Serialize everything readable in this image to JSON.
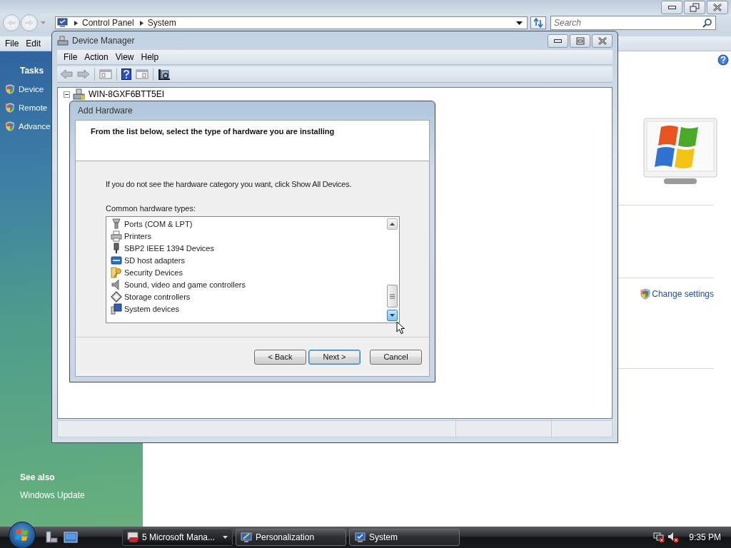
{
  "explorer": {
    "breadcrumbs": [
      "Control Panel",
      "System"
    ],
    "search": {
      "placeholder": "Search"
    },
    "menu": [
      "File",
      "Edit"
    ],
    "tasks": {
      "heading": "Tasks",
      "links": [
        "Device",
        "Remote",
        "Advance"
      ]
    },
    "see_also": {
      "heading": "See also",
      "links": [
        "Windows Update"
      ]
    },
    "change_settings": "Change settings"
  },
  "device_manager": {
    "title": "Device Manager",
    "menu": [
      "File",
      "Action",
      "View",
      "Help"
    ],
    "tree_root": "WIN-8GXF6BTT5EI"
  },
  "add_hardware": {
    "title": "Add Hardware",
    "heading": "From the list below, select the type of hardware you are installing",
    "instruction": "If you do not see the hardware category you want, click Show All Devices.",
    "list_label": "Common hardware types:",
    "items": [
      {
        "label": "Ports (COM & LPT)",
        "selected": false
      },
      {
        "label": "Printers",
        "selected": false
      },
      {
        "label": "SBP2 IEEE 1394 Devices",
        "selected": false
      },
      {
        "label": "SD host adapters",
        "selected": false
      },
      {
        "label": "Security Devices",
        "selected": false
      },
      {
        "label": "Sound, video and game controllers",
        "selected": false
      },
      {
        "label": "Storage controllers",
        "selected": false
      },
      {
        "label": "System devices",
        "selected": false
      }
    ],
    "buttons": [
      {
        "label": "< Back",
        "default": false
      },
      {
        "label": "Next >",
        "default": true
      },
      {
        "label": "Cancel",
        "default": false
      }
    ]
  },
  "taskbar": {
    "tasks": [
      {
        "label": "5 Microsoft Mana...",
        "kind": "group"
      },
      {
        "label": "Personalization",
        "kind": "window"
      },
      {
        "label": "System",
        "kind": "window"
      }
    ],
    "clock": "9:35 PM"
  }
}
